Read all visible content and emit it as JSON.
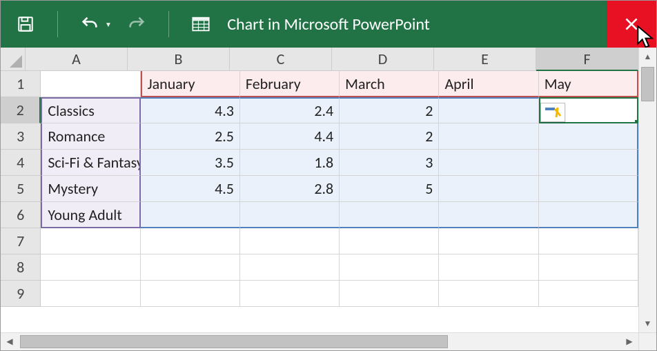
{
  "window": {
    "title": "Chart in Microsoft PowerPoint"
  },
  "columns": [
    "A",
    "B",
    "C",
    "D",
    "E",
    "F"
  ],
  "active_col_index": 5,
  "row_count": 9,
  "active_row_index": 1,
  "sheet": {
    "col_headers": [
      "",
      "January",
      "February",
      "March",
      "April",
      "May"
    ],
    "rows": [
      {
        "label": "Classics",
        "values": [
          "4.3",
          "2.4",
          "2",
          "",
          ""
        ]
      },
      {
        "label": "Romance",
        "values": [
          "2.5",
          "4.4",
          "2",
          "",
          ""
        ]
      },
      {
        "label": "Sci-Fi & Fantasy",
        "values": [
          "3.5",
          "1.8",
          "3",
          "",
          ""
        ]
      },
      {
        "label": "Mystery",
        "values": [
          "4.5",
          "2.8",
          "5",
          "",
          ""
        ]
      },
      {
        "label": "Young Adult",
        "values": [
          "",
          "",
          "",
          "",
          ""
        ]
      }
    ]
  },
  "chart_data": {
    "type": "bar",
    "categories": [
      "January",
      "February",
      "March",
      "April",
      "May"
    ],
    "series": [
      {
        "name": "Classics",
        "values": [
          4.3,
          2.4,
          2,
          null,
          null
        ]
      },
      {
        "name": "Romance",
        "values": [
          2.5,
          4.4,
          2,
          null,
          null
        ]
      },
      {
        "name": "Sci-Fi & Fantasy",
        "values": [
          3.5,
          1.8,
          3,
          null,
          null
        ]
      },
      {
        "name": "Mystery",
        "values": [
          4.5,
          2.8,
          5,
          null,
          null
        ]
      },
      {
        "name": "Young Adult",
        "values": [
          null,
          null,
          null,
          null,
          null
        ]
      }
    ],
    "title": "",
    "xlabel": "",
    "ylabel": ""
  }
}
